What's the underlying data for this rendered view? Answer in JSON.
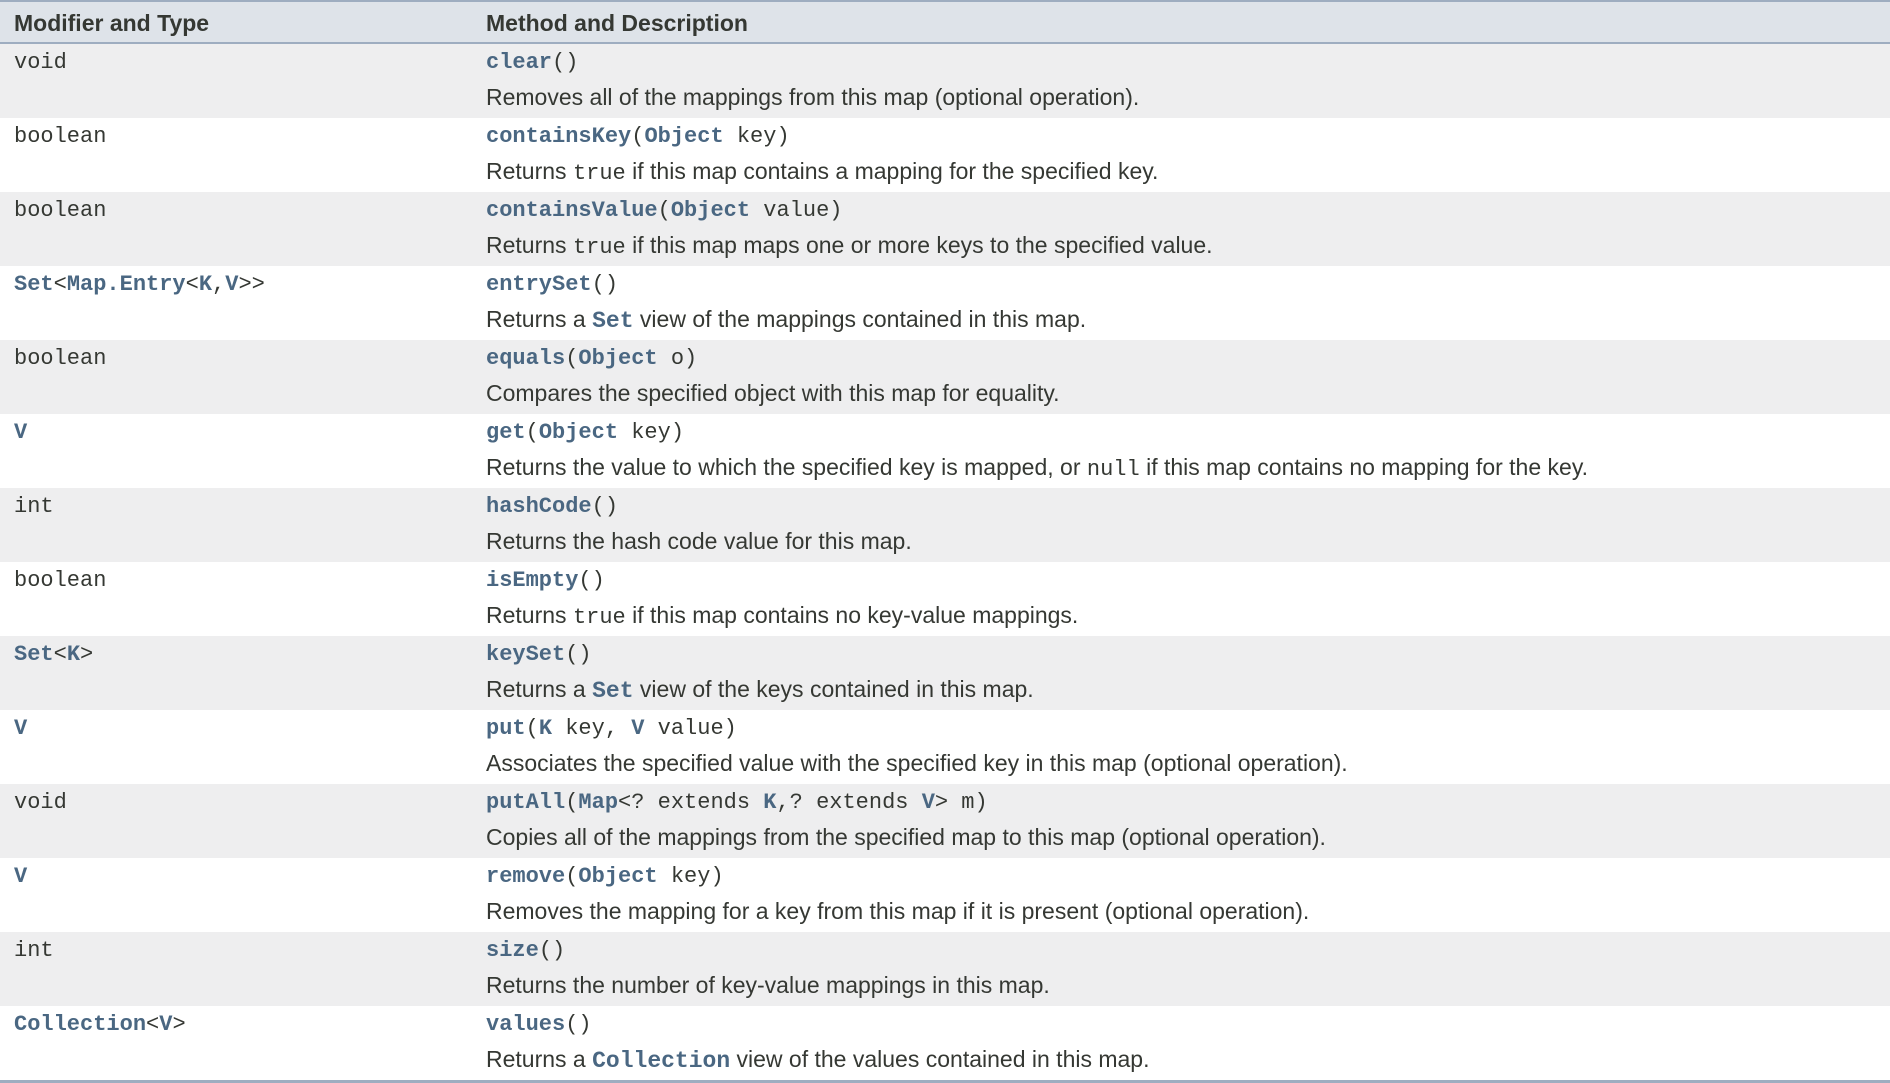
{
  "header": {
    "col1": "Modifier and Type",
    "col2": "Method and Description"
  },
  "rows": [
    {
      "type": [
        {
          "t": "void",
          "link": false
        }
      ],
      "sig": [
        {
          "t": "clear",
          "link": true
        },
        {
          "t": "()",
          "link": false
        }
      ],
      "desc": [
        {
          "t": "Removes all of the mappings from this map (optional operation).",
          "code": false
        }
      ]
    },
    {
      "type": [
        {
          "t": "boolean",
          "link": false
        }
      ],
      "sig": [
        {
          "t": "containsKey",
          "link": true
        },
        {
          "t": "(",
          "link": false
        },
        {
          "t": "Object",
          "link": true
        },
        {
          "t": " key)",
          "link": false
        }
      ],
      "desc": [
        {
          "t": "Returns ",
          "code": false
        },
        {
          "t": "true",
          "code": true
        },
        {
          "t": " if this map contains a mapping for the specified key.",
          "code": false
        }
      ]
    },
    {
      "type": [
        {
          "t": "boolean",
          "link": false
        }
      ],
      "sig": [
        {
          "t": "containsValue",
          "link": true
        },
        {
          "t": "(",
          "link": false
        },
        {
          "t": "Object",
          "link": true
        },
        {
          "t": " value)",
          "link": false
        }
      ],
      "desc": [
        {
          "t": "Returns ",
          "code": false
        },
        {
          "t": "true",
          "code": true
        },
        {
          "t": " if this map maps one or more keys to the specified value.",
          "code": false
        }
      ]
    },
    {
      "type": [
        {
          "t": "Set",
          "link": true
        },
        {
          "t": "<",
          "link": false
        },
        {
          "t": "Map.Entry",
          "link": true
        },
        {
          "t": "<",
          "link": false
        },
        {
          "t": "K",
          "link": true
        },
        {
          "t": ",",
          "link": false
        },
        {
          "t": "V",
          "link": true
        },
        {
          "t": ">>",
          "link": false
        }
      ],
      "sig": [
        {
          "t": "entrySet",
          "link": true
        },
        {
          "t": "()",
          "link": false
        }
      ],
      "desc": [
        {
          "t": "Returns a ",
          "code": false
        },
        {
          "t": "Set",
          "code": true,
          "link": true
        },
        {
          "t": " view of the mappings contained in this map.",
          "code": false
        }
      ]
    },
    {
      "type": [
        {
          "t": "boolean",
          "link": false
        }
      ],
      "sig": [
        {
          "t": "equals",
          "link": true
        },
        {
          "t": "(",
          "link": false
        },
        {
          "t": "Object",
          "link": true
        },
        {
          "t": " o)",
          "link": false
        }
      ],
      "desc": [
        {
          "t": "Compares the specified object with this map for equality.",
          "code": false
        }
      ]
    },
    {
      "type": [
        {
          "t": "V",
          "link": true
        }
      ],
      "sig": [
        {
          "t": "get",
          "link": true
        },
        {
          "t": "(",
          "link": false
        },
        {
          "t": "Object",
          "link": true
        },
        {
          "t": " key)",
          "link": false
        }
      ],
      "desc": [
        {
          "t": "Returns the value to which the specified key is mapped, or ",
          "code": false
        },
        {
          "t": "null",
          "code": true
        },
        {
          "t": " if this map contains no mapping for the key.",
          "code": false
        }
      ]
    },
    {
      "type": [
        {
          "t": "int",
          "link": false
        }
      ],
      "sig": [
        {
          "t": "hashCode",
          "link": true
        },
        {
          "t": "()",
          "link": false
        }
      ],
      "desc": [
        {
          "t": "Returns the hash code value for this map.",
          "code": false
        }
      ]
    },
    {
      "type": [
        {
          "t": "boolean",
          "link": false
        }
      ],
      "sig": [
        {
          "t": "isEmpty",
          "link": true
        },
        {
          "t": "()",
          "link": false
        }
      ],
      "desc": [
        {
          "t": "Returns ",
          "code": false
        },
        {
          "t": "true",
          "code": true
        },
        {
          "t": " if this map contains no key-value mappings.",
          "code": false
        }
      ]
    },
    {
      "type": [
        {
          "t": "Set",
          "link": true
        },
        {
          "t": "<",
          "link": false
        },
        {
          "t": "K",
          "link": true
        },
        {
          "t": ">",
          "link": false
        }
      ],
      "sig": [
        {
          "t": "keySet",
          "link": true
        },
        {
          "t": "()",
          "link": false
        }
      ],
      "desc": [
        {
          "t": "Returns a ",
          "code": false
        },
        {
          "t": "Set",
          "code": true,
          "link": true
        },
        {
          "t": " view of the keys contained in this map.",
          "code": false
        }
      ]
    },
    {
      "type": [
        {
          "t": "V",
          "link": true
        }
      ],
      "sig": [
        {
          "t": "put",
          "link": true
        },
        {
          "t": "(",
          "link": false
        },
        {
          "t": "K",
          "link": true
        },
        {
          "t": " key, ",
          "link": false
        },
        {
          "t": "V",
          "link": true
        },
        {
          "t": " value)",
          "link": false
        }
      ],
      "desc": [
        {
          "t": "Associates the specified value with the specified key in this map (optional operation).",
          "code": false
        }
      ]
    },
    {
      "type": [
        {
          "t": "void",
          "link": false
        }
      ],
      "sig": [
        {
          "t": "putAll",
          "link": true
        },
        {
          "t": "(",
          "link": false
        },
        {
          "t": "Map",
          "link": true
        },
        {
          "t": "<? extends ",
          "link": false
        },
        {
          "t": "K",
          "link": true
        },
        {
          "t": ",? extends ",
          "link": false
        },
        {
          "t": "V",
          "link": true
        },
        {
          "t": "> m)",
          "link": false
        }
      ],
      "desc": [
        {
          "t": "Copies all of the mappings from the specified map to this map (optional operation).",
          "code": false
        }
      ]
    },
    {
      "type": [
        {
          "t": "V",
          "link": true
        }
      ],
      "sig": [
        {
          "t": "remove",
          "link": true
        },
        {
          "t": "(",
          "link": false
        },
        {
          "t": "Object",
          "link": true
        },
        {
          "t": " key)",
          "link": false
        }
      ],
      "desc": [
        {
          "t": "Removes the mapping for a key from this map if it is present (optional operation).",
          "code": false
        }
      ]
    },
    {
      "type": [
        {
          "t": "int",
          "link": false
        }
      ],
      "sig": [
        {
          "t": "size",
          "link": true
        },
        {
          "t": "()",
          "link": false
        }
      ],
      "desc": [
        {
          "t": "Returns the number of key-value mappings in this map.",
          "code": false
        }
      ]
    },
    {
      "type": [
        {
          "t": "Collection",
          "link": true
        },
        {
          "t": "<",
          "link": false
        },
        {
          "t": "V",
          "link": true
        },
        {
          "t": ">",
          "link": false
        }
      ],
      "sig": [
        {
          "t": "values",
          "link": true
        },
        {
          "t": "()",
          "link": false
        }
      ],
      "desc": [
        {
          "t": "Returns a ",
          "code": false
        },
        {
          "t": "Collection",
          "code": true,
          "link": true
        },
        {
          "t": " view of the values contained in this map.",
          "code": false
        }
      ]
    }
  ],
  "colors": {
    "header_bg": "#dee3e9",
    "alt_row_bg": "#eeeeef",
    "link": "#4a6782",
    "text": "#353833",
    "border": "#9eadc0"
  }
}
